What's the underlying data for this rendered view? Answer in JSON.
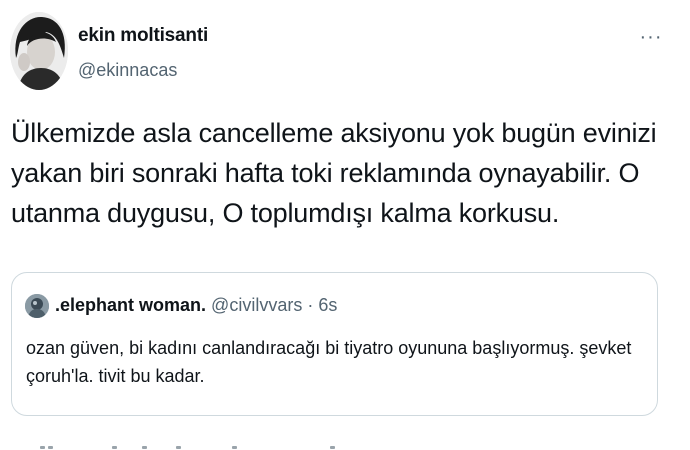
{
  "author": {
    "name": "ekin moltisanti",
    "handle": "@ekinnacas"
  },
  "more_icon": "more-horizontal-icon",
  "more_label": "···",
  "tweet": {
    "text": "Ülkemizde asla cancelleme aksiyonu yok bugün evinizi\nyakan biri sonraki hafta toki reklamında oynayabilir. O\nutanma duygusu, O toplumdışı kalma korkusu."
  },
  "quote": {
    "name": ".elephant woman.",
    "handle": "@civilvvars",
    "separator": "·",
    "time": "6s",
    "text": "ozan güven, bi kadını canlandıracağı bi tiyatro oyununa başlıyormuş. şevket\nçoruh'la. tivit bu kadar."
  },
  "colors": {
    "text_primary": "#0f1419",
    "text_secondary": "#536471",
    "border": "#cfd9de"
  }
}
